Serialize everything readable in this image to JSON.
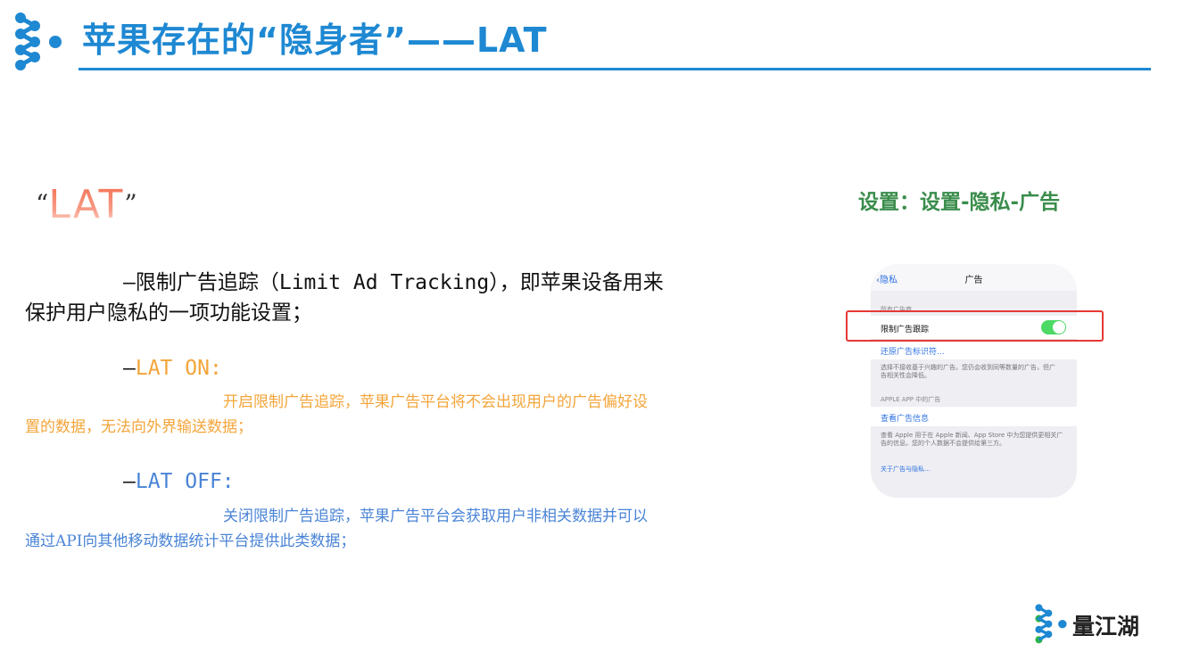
{
  "header": {
    "title": "苹果存在的“隐身者”——LAT"
  },
  "lat_heading": {
    "open_quote": "“",
    "label": "LAT",
    "close_quote": "”"
  },
  "main_paragraph": {
    "line1": "—限制广告追踪（Limit Ad Tracking），即苹果设备用来",
    "line2": "保护用户隐私的一项功能设置；"
  },
  "lat_on": {
    "dash": "—",
    "label": "LAT ON:",
    "line1": "开启限制广告追踪，苹果广告平台将不会出现用户的广告偏好设",
    "line2": "置的数据，无法向外界输送数据；"
  },
  "lat_off": {
    "dash": "—",
    "label": "LAT OFF:",
    "line1": "关闭限制广告追踪，苹果广告平台会获取用户非相关数据并可以",
    "line2": "通过API向其他移动数据统计平台提供此类数据；"
  },
  "settings_caption": "设置：设置-隐私-广告",
  "phone": {
    "back_label": "隐私",
    "nav_title": "广告",
    "section_all_ads": "所有广告商",
    "limit_tracking_label": "限制广告跟踪",
    "toggle_on": true,
    "reset_identifier": "还原广告标识符...",
    "note1_line1": "选择不接收基于兴趣的广告。您仍会收到同等数量的广告，但广",
    "note1_line2": "告相关性会降低。",
    "section_apple": "APPLE APP 中的广告",
    "view_ad_info": "查看广告信息",
    "note2_line1": "查看 Apple 用于在 Apple 新闻、App Store 中为您提供更相关广",
    "note2_line2": "告的信息。您的个人数据不会提供给第三方。",
    "about_link": "关于广告与隐私..."
  },
  "brand": {
    "name": "量江湖"
  },
  "colors": {
    "title_blue": "#1e88d2",
    "lat_on_orange": "#f3a53a",
    "lat_off_blue": "#4a84d6",
    "caption_green": "#3a8d4c",
    "highlight_red": "#e53935"
  }
}
